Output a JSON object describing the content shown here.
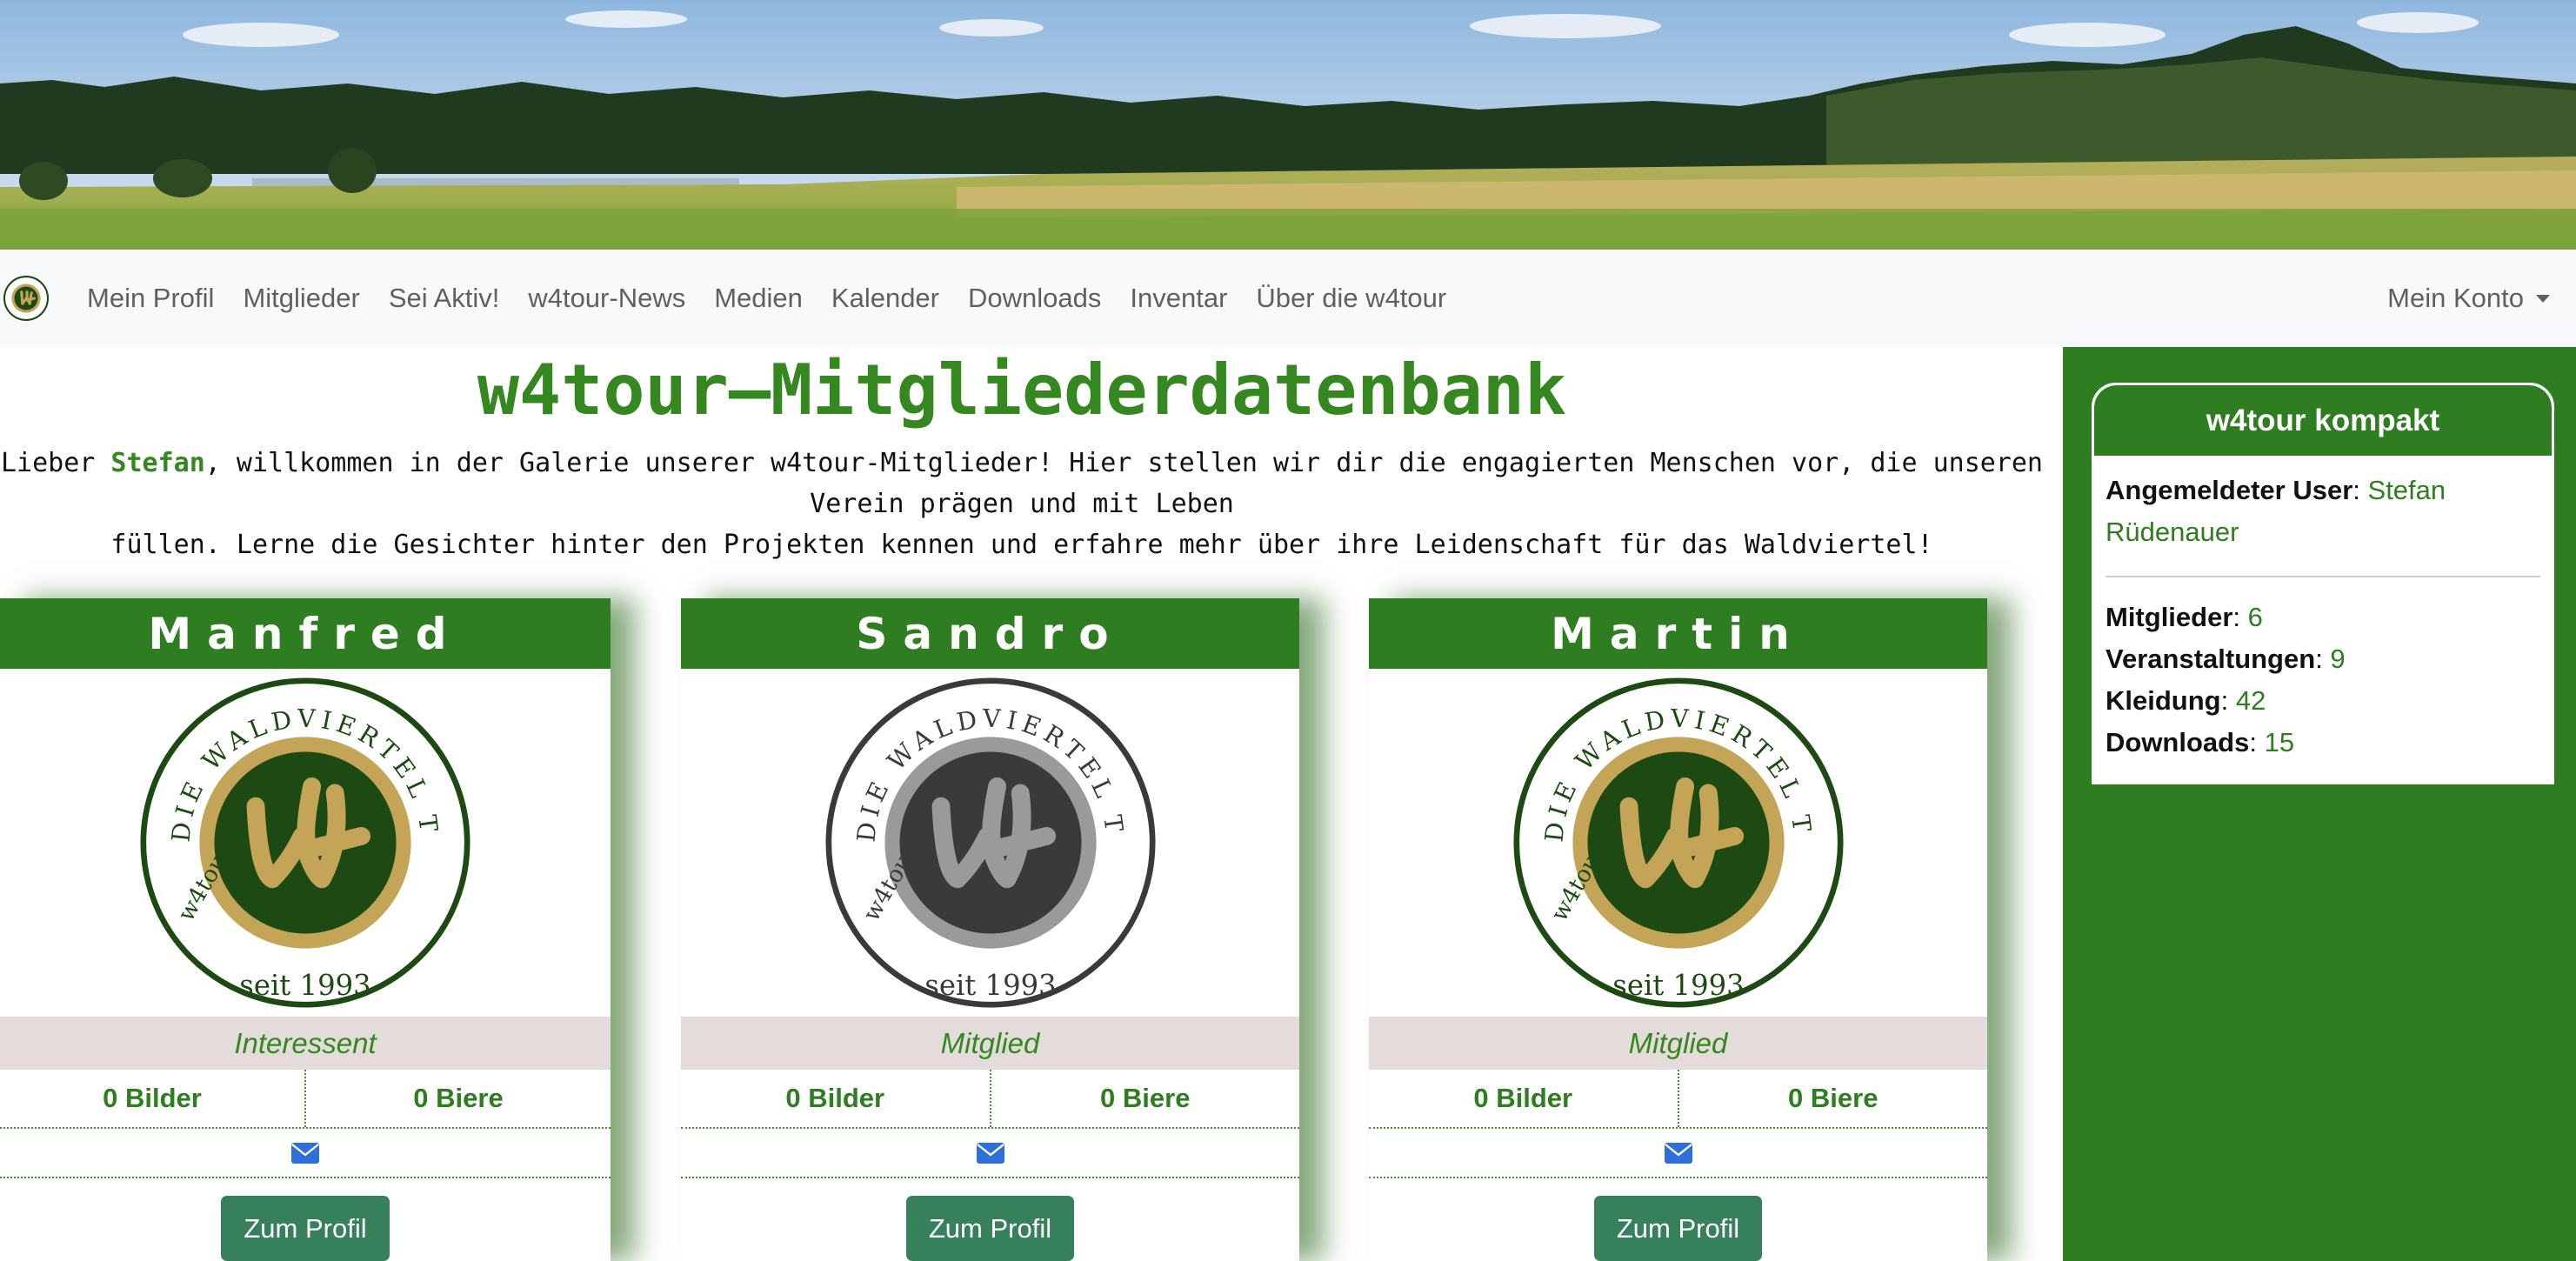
{
  "nav": {
    "items": [
      "Mein Profil",
      "Mitglieder",
      "Sei Aktiv!",
      "w4tour-News",
      "Medien",
      "Kalender",
      "Downloads",
      "Inventar",
      "Über die w4tour"
    ],
    "account": "Mein Konto"
  },
  "main": {
    "title": "w4tour–Mitgliederdatenbank",
    "intro_prefix": "Lieber ",
    "intro_name": "Stefan",
    "intro_line1_rest": ", willkommen in der Galerie unserer w4tour-Mitglieder! Hier stellen wir dir die engagierten Menschen vor, die unseren Verein prägen und mit Leben",
    "intro_line2": "füllen. Lerne die Gesichter hinter den Projekten kennen und erfahre mehr über ihre Leidenschaft für das Waldviertel!"
  },
  "logo": {
    "ring_text": "DIE WALDVIERTEL TOUR",
    "bottom_left": "w4tour",
    "since": "seit 1993",
    "colors": {
      "green": "#1d4a12",
      "gold": "#c4a457",
      "grey": "#9a9a9a",
      "dark": "#3a3a3a"
    }
  },
  "members": [
    {
      "name": "Manfred",
      "status": "Interessent",
      "pictures": "0 Bilder",
      "beers": "0 Biere",
      "button": "Zum Profil",
      "logo_variant": "color"
    },
    {
      "name": "Sandro",
      "status": "Mitglied",
      "pictures": "0 Bilder",
      "beers": "0 Biere",
      "button": "Zum Profil",
      "logo_variant": "grey"
    },
    {
      "name": "Martin",
      "status": "Mitglied",
      "pictures": "0 Bilder",
      "beers": "0 Biere",
      "button": "Zum Profil",
      "logo_variant": "color"
    }
  ],
  "sidebar": {
    "title": "w4tour kompakt",
    "user_label": "Angemeldeter User",
    "user_value": "Stefan Rüdenauer",
    "stats": [
      {
        "label": "Mitglieder",
        "value": "6"
      },
      {
        "label": "Veranstaltungen",
        "value": "9"
      },
      {
        "label": "Kleidung",
        "value": "42"
      },
      {
        "label": "Downloads",
        "value": "15"
      }
    ]
  },
  "colors": {
    "brand_green": "#2e7d20",
    "button_green": "#36805b",
    "status_bg": "#e4dcdb",
    "mail_blue": "#2f6fd8"
  }
}
